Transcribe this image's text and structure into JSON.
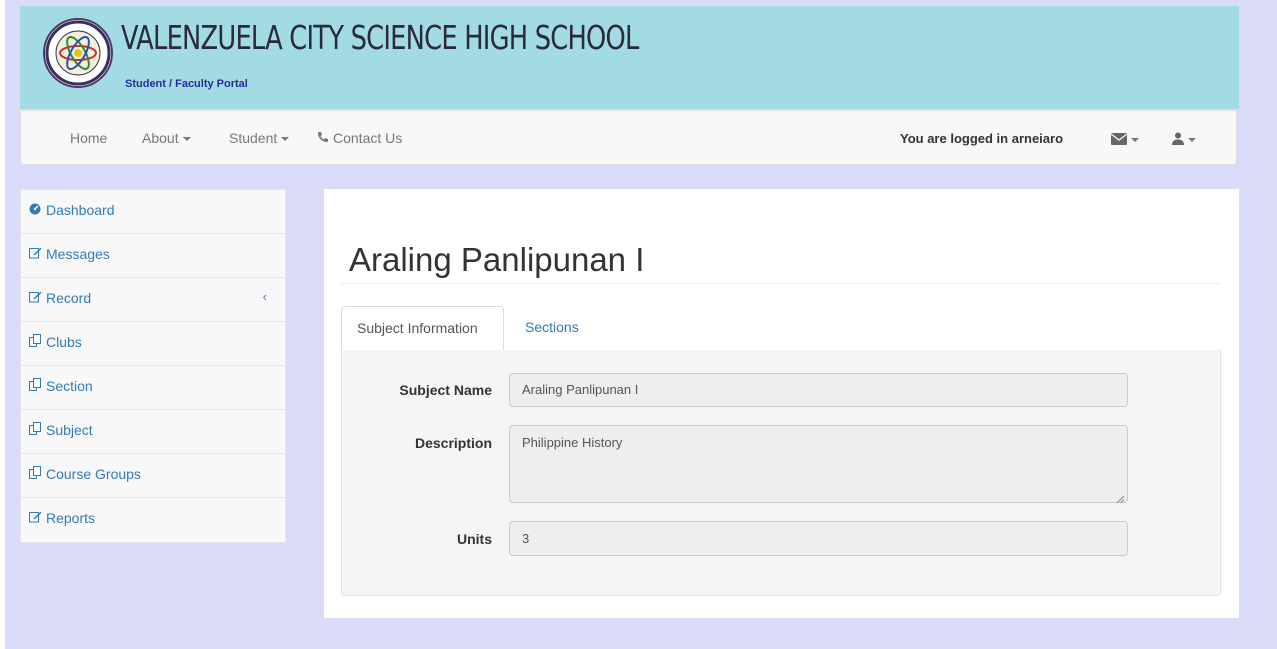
{
  "header": {
    "school_name": "VALENZUELA CITY SCIENCE HIGH SCHOOL",
    "subtitle": "Student / Faculty Portal",
    "logo_icon": "school-seal-icon"
  },
  "navbar": {
    "items": [
      {
        "label": "Home",
        "dropdown": false
      },
      {
        "label": "About",
        "dropdown": true
      },
      {
        "label": "Student",
        "dropdown": true
      },
      {
        "label": "Contact Us",
        "icon": "phone-icon"
      }
    ],
    "logged_in_text": "You are logged in arneiaro",
    "right_icons": [
      "envelope-icon",
      "user-icon"
    ]
  },
  "sidebar": {
    "items": [
      {
        "label": "Dashboard",
        "icon": "dashboard-icon"
      },
      {
        "label": "Messages",
        "icon": "edit-icon"
      },
      {
        "label": "Record",
        "icon": "edit-icon",
        "chevron": "‹"
      },
      {
        "label": "Clubs",
        "icon": "copy-icon"
      },
      {
        "label": "Section",
        "icon": "copy-icon"
      },
      {
        "label": "Subject",
        "icon": "copy-icon"
      },
      {
        "label": "Course Groups",
        "icon": "copy-icon"
      },
      {
        "label": "Reports",
        "icon": "edit-icon"
      }
    ]
  },
  "main": {
    "title": "Araling Panlipunan I",
    "tabs": [
      {
        "label": "Subject Information",
        "active": true
      },
      {
        "label": "Sections",
        "active": false
      }
    ],
    "fields": {
      "subject_name": {
        "label": "Subject Name",
        "value": "Araling Panlipunan I"
      },
      "description": {
        "label": "Description",
        "value": "Philippine History"
      },
      "units": {
        "label": "Units",
        "value": "3"
      }
    }
  },
  "colors": {
    "page_bg": "#d9dbf9",
    "banner_bg": "#a3dbe4",
    "link": "#337ab7",
    "subtitle": "#2a2b9a"
  }
}
